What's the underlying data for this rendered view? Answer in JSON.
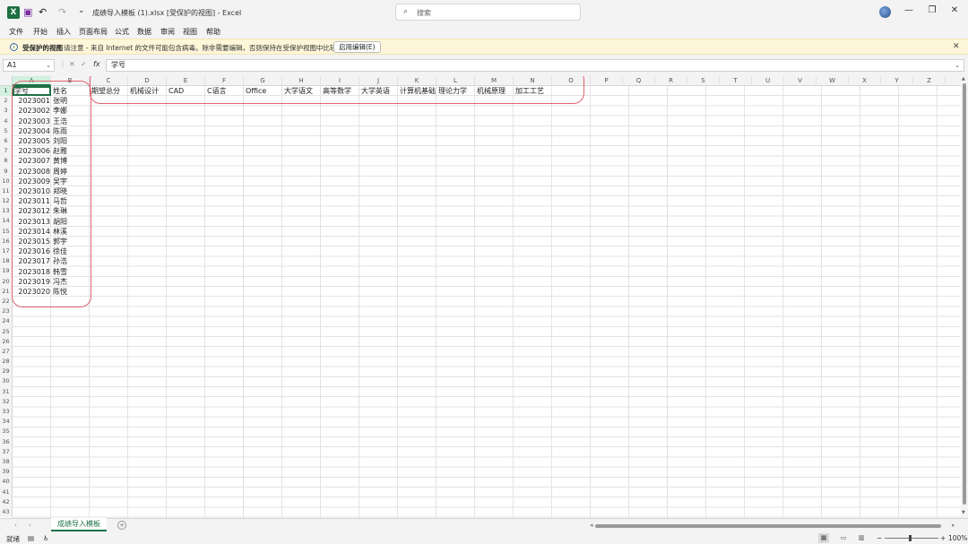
{
  "window": {
    "app_icon": "X",
    "title": "成绩导入模板 (1).xlsx  [受保护的视图]  -  Excel",
    "search_placeholder": "搜索",
    "search_icon": "⌕",
    "undo_icon": "↶",
    "redo_icon": "↷",
    "save_icon": "▣",
    "customize_icon": "⌄",
    "minimize_icon": "—",
    "restore_icon": "❐",
    "close_icon": "✕"
  },
  "menu": {
    "items": [
      "文件",
      "开始",
      "插入",
      "页面布局",
      "公式",
      "数据",
      "审阅",
      "视图",
      "帮助"
    ]
  },
  "message_bar": {
    "icon": "i",
    "title": "受保护的视图",
    "text": "请注意 - 来自 Internet 的文件可能包含病毒。除非需要编辑，否则保持在受保护视图中比较安全。",
    "button": "启用编辑(E)",
    "close_icon": "✕"
  },
  "formula_bar": {
    "name_box": "A1",
    "dropdown_icon": "⌄",
    "cancel_icon": "✕",
    "enter_icon": "✓",
    "fx_label": "fx",
    "content": "学号"
  },
  "grid": {
    "columns": [
      "A",
      "B",
      "C",
      "D",
      "E",
      "F",
      "G",
      "H",
      "I",
      "J",
      "K",
      "L",
      "M",
      "N",
      "O",
      "P",
      "Q",
      "R",
      "S",
      "T",
      "U",
      "V",
      "W",
      "X",
      "Y",
      "Z"
    ],
    "rows": [
      "1",
      "2",
      "3",
      "4",
      "5",
      "6",
      "7",
      "8",
      "9",
      "10",
      "11",
      "12",
      "13",
      "14",
      "15",
      "16",
      "17",
      "18",
      "19",
      "20",
      "21",
      "22",
      "23",
      "24",
      "25",
      "26",
      "27",
      "28",
      "29",
      "30",
      "31",
      "32",
      "33",
      "34",
      "35",
      "36",
      "37",
      "38",
      "39",
      "40",
      "41",
      "42",
      "43"
    ],
    "headers": [
      "学号",
      "姓名",
      "期望总分",
      "机械设计",
      "CAD",
      "C语言",
      "Office",
      "大学语文",
      "高等数学",
      "大学英语",
      "计算机基础",
      "理论力学",
      "机械原理",
      "加工工艺"
    ],
    "students": [
      {
        "id": "2023001",
        "name": "张明"
      },
      {
        "id": "2023002",
        "name": "李娜"
      },
      {
        "id": "2023003",
        "name": "王浩"
      },
      {
        "id": "2023004",
        "name": "陈雨"
      },
      {
        "id": "2023005",
        "name": "刘阳"
      },
      {
        "id": "2023006",
        "name": "赵雅"
      },
      {
        "id": "2023007",
        "name": "黄博"
      },
      {
        "id": "2023008",
        "name": "周婷"
      },
      {
        "id": "2023009",
        "name": "吴宇"
      },
      {
        "id": "2023010",
        "name": "郑晓"
      },
      {
        "id": "2023011",
        "name": "马哲"
      },
      {
        "id": "2023012",
        "name": "朱琳"
      },
      {
        "id": "2023013",
        "name": "胡阳"
      },
      {
        "id": "2023014",
        "name": "林溪"
      },
      {
        "id": "2023015",
        "name": "郭宇"
      },
      {
        "id": "2023016",
        "name": "徐佳"
      },
      {
        "id": "2023017",
        "name": "孙浩"
      },
      {
        "id": "2023018",
        "name": "韩雪"
      },
      {
        "id": "2023019",
        "name": "冯杰"
      },
      {
        "id": "2023020",
        "name": "陈悦"
      }
    ]
  },
  "sheet_tabs": {
    "active": "成绩导入模板",
    "add_icon": "+",
    "prev_icon": "‹",
    "next_icon": "›"
  },
  "status": {
    "ready": "就绪",
    "zoom": "100%",
    "zoom_minus": "−",
    "zoom_plus": "+",
    "highlight_color": "#e06370",
    "accent_color": "#1e7145"
  }
}
